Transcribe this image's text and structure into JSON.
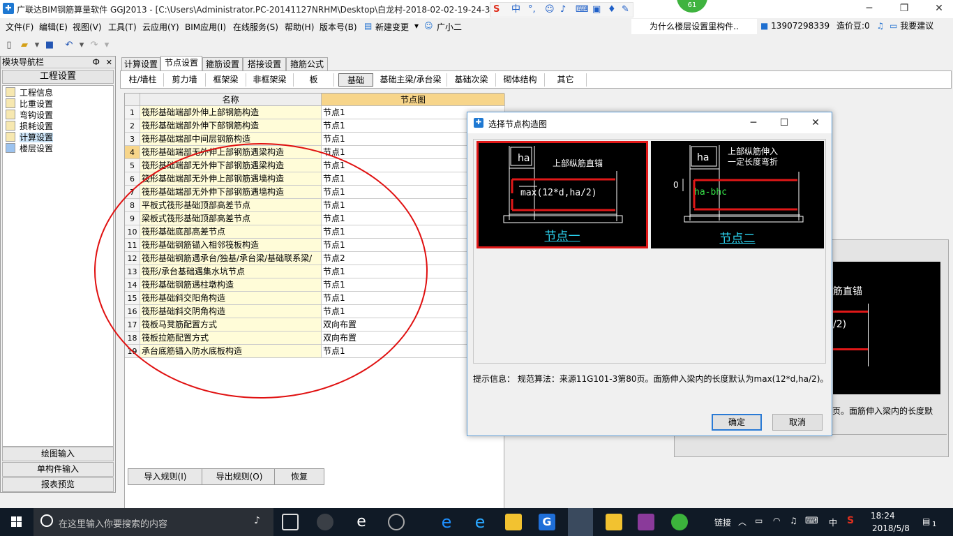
{
  "titlebar": {
    "title": "广联达BIM钢筋算量软件 GGJ2013 - [C:\\Users\\Administrator.PC-20141127NRHM\\Desktop\\白龙村-2018-02-02-19-24-35",
    "badge": "61",
    "ime": "中"
  },
  "menubar": {
    "items": [
      "文件(F)",
      "编辑(E)",
      "视图(V)",
      "工具(T)",
      "云应用(Y)",
      "BIM应用(I)",
      "在线服务(S)",
      "帮助(H)",
      "版本号(B)",
      "新建变更",
      "广小二"
    ],
    "news": "为什么楼层设置里构件..",
    "phone": "13907298339",
    "coins": "造价豆:0",
    "suggest": "我要建议"
  },
  "nav": {
    "title": "模块导航栏",
    "pin": "Ф",
    "close": "✕",
    "section": "工程设置",
    "items": [
      "工程信息",
      "比重设置",
      "弯钩设置",
      "损耗设置",
      "计算设置",
      "楼层设置"
    ],
    "buttons": [
      "绘图输入",
      "单构件输入",
      "报表预览"
    ]
  },
  "tabs": [
    "计算设置",
    "节点设置",
    "箍筋设置",
    "搭接设置",
    "箍筋公式"
  ],
  "subtabs": [
    "柱/墙柱",
    "剪力墙",
    "框架梁",
    "非框架梁",
    "板",
    "基础",
    "基础主梁/承台梁",
    "基础次梁",
    "砌体结构",
    "其它"
  ],
  "grid": {
    "headers": [
      "名称",
      "节点图"
    ],
    "rows": [
      {
        "num": "1",
        "name": "筏形基础端部外伸上部钢筋构造",
        "node": "节点1"
      },
      {
        "num": "2",
        "name": "筏形基础端部外伸下部钢筋构造",
        "node": "节点1"
      },
      {
        "num": "3",
        "name": "筏形基础端部中间层钢筋构造",
        "node": "节点1"
      },
      {
        "num": "4",
        "name": "筏形基础端部无外伸上部钢筋遇梁构造",
        "node": "节点1"
      },
      {
        "num": "5",
        "name": "筏形基础端部无外伸下部钢筋遇梁构造",
        "node": "节点1"
      },
      {
        "num": "6",
        "name": "筏形基础端部无外伸上部钢筋遇墙构造",
        "node": "节点1"
      },
      {
        "num": "7",
        "name": "筏形基础端部无外伸下部钢筋遇墙构造",
        "node": "节点1"
      },
      {
        "num": "8",
        "name": "平板式筏形基础顶部高差节点",
        "node": "节点1"
      },
      {
        "num": "9",
        "name": "梁板式筏形基础顶部高差节点",
        "node": "节点1"
      },
      {
        "num": "10",
        "name": "筏形基础底部高差节点",
        "node": "节点1"
      },
      {
        "num": "11",
        "name": "筏形基础钢筋锚入相邻筏板构造",
        "node": "节点1"
      },
      {
        "num": "12",
        "name": "筏形基础钢筋遇承台/独基/承台梁/基础联系梁/",
        "node": "节点2"
      },
      {
        "num": "13",
        "name": "筏形/承台基础遇集水坑节点",
        "node": "节点1"
      },
      {
        "num": "14",
        "name": "筏形基础钢筋遇柱墩构造",
        "node": "节点1"
      },
      {
        "num": "15",
        "name": "筏形基础斜交阳角构造",
        "node": "节点1"
      },
      {
        "num": "16",
        "name": "筏形基础斜交阴角构造",
        "node": "节点1"
      },
      {
        "num": "17",
        "name": "筏板马凳筋配置方式",
        "node": "双向布置"
      },
      {
        "num": "18",
        "name": "筏板拉筋配置方式",
        "node": "双向布置"
      },
      {
        "num": "19",
        "name": "承台底筋锚入防水底板构造",
        "node": "节点1"
      }
    ]
  },
  "bottom_buttons": [
    "导入规则(I)",
    "导出规则(O)",
    "恢复"
  ],
  "bg_preview": {
    "label1": "筋直锚",
    "label2": "/2)",
    "hint": "页。面筋伸入梁内的长度默"
  },
  "dialog": {
    "title": "选择节点构造图",
    "thumbs": [
      {
        "label": "节点一",
        "note": "上部纵筋直锚",
        "dim": "ha",
        "formula": "max(12*d,ha/2)"
      },
      {
        "label": "节点二",
        "note": "上部纵筋伸入",
        "note2": "一定长度弯折",
        "dim": "ha",
        "formula": "ha-bhc",
        "zero": "0"
      }
    ],
    "hint": "提示信息： 规范算法：来源11G101-3第80页。面筋伸入梁内的长度默认为max(12*d,ha/2)。",
    "ok": "确定",
    "cancel": "取消"
  },
  "taskbar": {
    "search_placeholder": "在这里输入你要搜索的内容",
    "tray_label": "链接",
    "ime": "中",
    "time": "18:24",
    "date": "2018/5/8",
    "notif": "1"
  },
  "colors": {
    "accent": "#1e78d2",
    "highlight_ring": "#e01010",
    "thumb_bg": "#000000",
    "thumb_label": "#2bd3f0"
  }
}
